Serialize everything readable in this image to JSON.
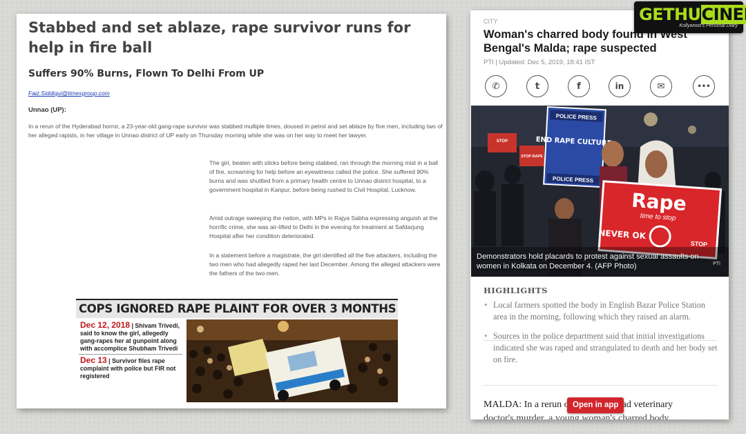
{
  "left_article": {
    "headline": "Stabbed and set ablaze, rape survivor runs for help in fire ball",
    "subheadline": "Suffers 90% Burns, Flown To Delhi From UP",
    "byline": "Faiz.Siddiqui@timesgroup.com",
    "dateline": "Unnao (UP):",
    "lead": "In a rerun of the Hyderabad horror, a 23-year-old gang-rape survivor was stabbed multiple times, doused in petrol and set ablaze by five men, including two of her alleged rapists, in her village in Unnao district of UP early on Thursday morning while she was on her way to meet her lawyer.",
    "paragraphs": [
      "The girl, beaten with sticks before being stabbed, ran through the morning mist in a ball of fire, screaming for help before an eyewitness called the police. She suffered 90% burns and was shuttled from a primary health centre to Unnao district hospital, to a government hospital in Kanpur, before being rushed to Civil Hospital, Lucknow.",
      "Amid outrage sweeping the nation, with MPs in Rajya Sabha expressing anguish at the horrific crime, she was air-lifted to Delhi in the evening for treatment at Safdarjung Hospital after her condition deteriorated.",
      "In a statement before a magistrate, the girl identified all the five attackers, including the two men who had allegedly raped her last December. Among the alleged attackers were the fathers of the two men."
    ],
    "inset": {
      "title": "COPS IGNORED RAPE PLAINT FOR OVER 3 MONTHS",
      "timeline": [
        {
          "date": "Dec 12, 2018",
          "sep": " | ",
          "text": "Shivam Trivedi, said to know the girl, allegedly gang-rapes her at gunpoint along with accomplice Shubham Trivedi"
        },
        {
          "date": "Dec 13",
          "sep": " | ",
          "text": "Survivor files rape complaint with police but FIR not registered"
        }
      ]
    }
  },
  "right_article": {
    "section": "CITY",
    "headline": "Woman's charred body found in West Bengal's Malda; rape suspected",
    "meta": "PTI | Updated: Dec 5, 2019, 18:41 IST",
    "share_icons": [
      "whatsapp-icon",
      "twitter-icon",
      "facebook-icon",
      "linkedin-icon",
      "email-icon",
      "more-icon"
    ],
    "share_glyphs": [
      "✆",
      "t",
      "f",
      "in",
      "✉",
      "•••"
    ],
    "photo": {
      "placards": [
        "POLICE PRESS",
        "END RAPE CULTURE.",
        "POLICE PRESS",
        "Rape",
        "time to stop",
        "NEVER OK",
        "STOP",
        "STOP RAPE"
      ],
      "caption": "Demonstrators hold placards to protest against sexual assaults on women in Kolkata on December 4. (AFP Photo)",
      "credit": "PTI"
    },
    "highlights_title": "HIGHLIGHTS",
    "highlights": [
      "Local farmers spotted the body in English Bazar Police Station area in the morning, following which they raised an alarm.",
      "Sources in the police department said that initial investigations indicated she was raped and strangulated to death and her body set on fire."
    ],
    "story_start": "MALDA: In a rerun of the Hyderabad veterinary",
    "story_line2": "doctor's murder, a young woman's charred body",
    "open_app_label": "Open in app"
  },
  "watermark": {
    "brand_a": "GETHU",
    "brand_b": "CINEMA",
    "tagline": "Kollywood's Personal Diary"
  },
  "colors": {
    "accent_red": "#d2262c",
    "brand_green": "#a9dd1b",
    "link_blue": "#1a3bb5"
  }
}
